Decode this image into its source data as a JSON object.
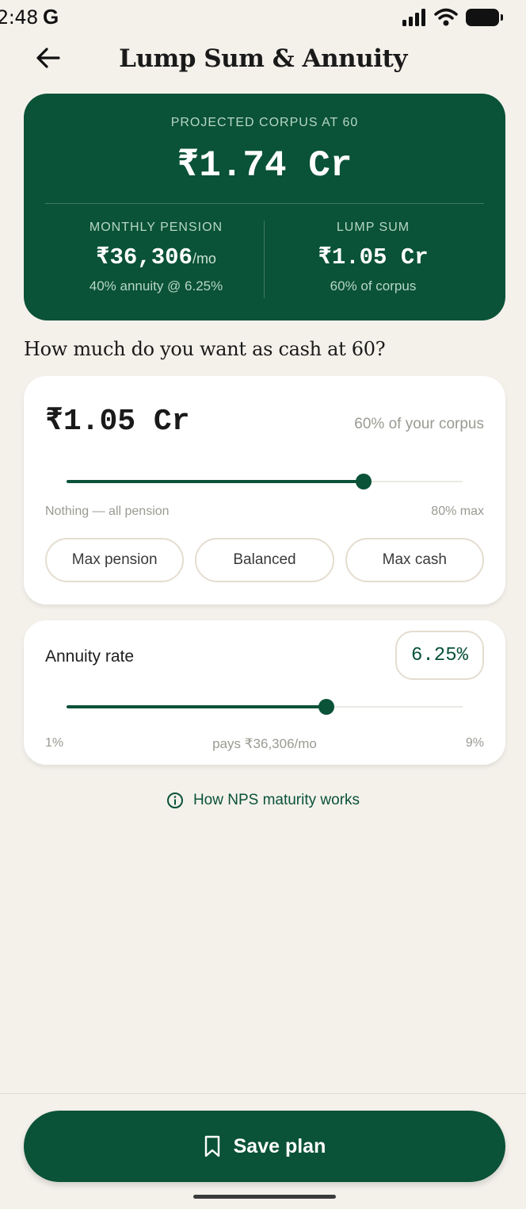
{
  "status_bar": {
    "time": "2:48",
    "app_icon": "G"
  },
  "header": {
    "title": "Lump Sum & Annuity"
  },
  "hero": {
    "label": "PROJECTED CORPUS AT 60",
    "value": "₹1.74 Cr",
    "pension": {
      "label": "MONTHLY PENSION",
      "value": "₹36,306",
      "unit": "/mo",
      "sub": "40% annuity @ 6.25%"
    },
    "lump_sum": {
      "label": "LUMP SUM",
      "value": "₹1.05 Cr",
      "sub": "60% of corpus"
    }
  },
  "question": "How much do you want as cash at 60?",
  "cash": {
    "value": "₹1.05 Cr",
    "pct_text": "60% of your corpus",
    "slider_fraction": 0.75,
    "min_label": "Nothing — all pension",
    "max_label": "80% max",
    "presets": [
      "Max pension",
      "Balanced",
      "Max cash"
    ]
  },
  "annuity": {
    "label": "Annuity rate",
    "value": "6.25%",
    "slider_fraction": 0.656,
    "min_label": "1%",
    "max_label": "9%",
    "pays_text": "pays ₹36,306/mo"
  },
  "info_link": "How NPS maturity works",
  "save_button": "Save plan",
  "colors": {
    "brand_green": "#0a5238",
    "background": "#f4f1eb"
  }
}
